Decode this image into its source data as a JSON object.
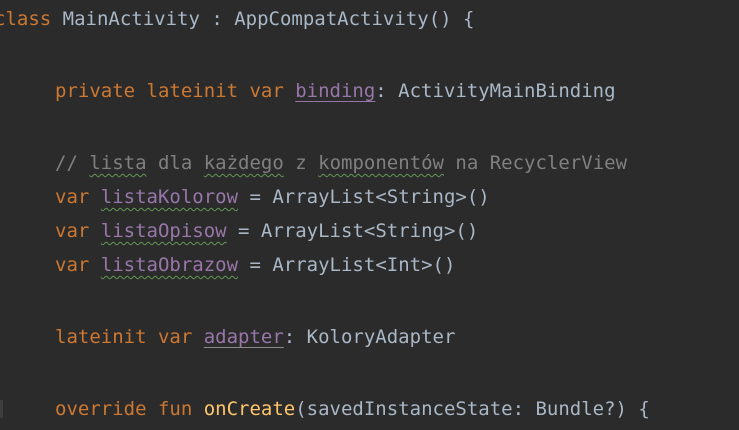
{
  "editor": {
    "lines": {
      "l1": {
        "kw_class": "class",
        "name": " MainActivity : AppCompatActivity() {"
      },
      "l2": {
        "kw": "private lateinit var ",
        "prop": "binding",
        "rest": ": ActivityMainBinding"
      },
      "l3": {
        "c1": "// ",
        "w1": "lista",
        "c2": " dla ",
        "w2": "każdego",
        "c3": " z ",
        "w3": "komponentów",
        "c4": " na RecyclerView"
      },
      "l4": {
        "kw": "var ",
        "prop": "listaKolorow",
        "rest": " = ArrayList<String>()"
      },
      "l5": {
        "kw": "var ",
        "prop": "listaOpisow",
        "rest": " = ArrayList<String>()"
      },
      "l6": {
        "kw": "var ",
        "prop": "listaObrazow",
        "rest": " = ArrayList<Int>()"
      },
      "l7": {
        "kw": "lateinit var ",
        "prop": "adapter",
        "rest": ": KoloryAdapter"
      },
      "l8": {
        "kw": "override fun ",
        "fn": "onCreate",
        "rest": "(savedInstanceState: Bundle?) {"
      }
    }
  }
}
